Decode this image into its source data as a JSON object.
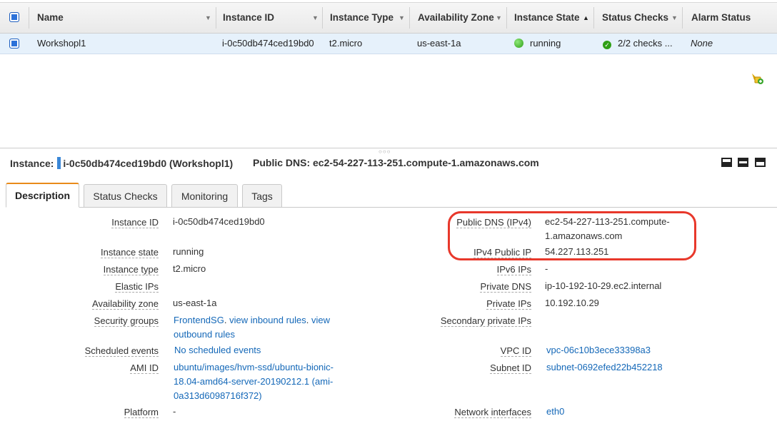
{
  "grid": {
    "columns": {
      "name": "Name",
      "instance_id": "Instance ID",
      "instance_type": "Instance Type",
      "availability_zone": "Availability Zone",
      "instance_state": "Instance State",
      "status_checks": "Status Checks",
      "alarm_status": "Alarm Status"
    },
    "row": {
      "name": "Workshopl1",
      "instance_id": "i-0c50db474ced19bd0",
      "instance_type": "t2.micro",
      "availability_zone": "us-east-1a",
      "instance_state": "running",
      "status_checks": "2/2 checks ...",
      "alarm_status": "None"
    }
  },
  "details": {
    "instance_label": "Instance:",
    "instance_value": "i-0c50db474ced19bd0 (Workshopl1)",
    "public_dns_label": "Public DNS:",
    "public_dns_value": "ec2-54-227-113-251.compute-1.amazonaws.com"
  },
  "tabs": [
    "Description",
    "Status Checks",
    "Monitoring",
    "Tags"
  ],
  "description": {
    "left": {
      "instance_id": {
        "label": "Instance ID",
        "value": "i-0c50db474ced19bd0"
      },
      "instance_state": {
        "label": "Instance state",
        "value": "running"
      },
      "instance_type": {
        "label": "Instance type",
        "value": "t2.micro"
      },
      "elastic_ips": {
        "label": "Elastic IPs",
        "value": ""
      },
      "availability_zone": {
        "label": "Availability zone",
        "value": "us-east-1a"
      },
      "security_groups": {
        "label": "Security groups",
        "group": "FrontendSG",
        "sep": ".",
        "inbound": "view inbound rules",
        "sep2": ".",
        "outbound_1": "view",
        "outbound_2": "outbound rules"
      },
      "scheduled_events": {
        "label": "Scheduled events",
        "value": "No scheduled events"
      },
      "ami_id": {
        "label": "AMI ID",
        "line1": "ubuntu/images/hvm-ssd/ubuntu-bionic-",
        "line2": "18.04-amd64-server-20190212.1 (ami-",
        "line3": "0a313d6098716f372)"
      },
      "platform": {
        "label": "Platform",
        "value": "-"
      }
    },
    "right": {
      "public_dns_ipv4": {
        "label": "Public DNS (IPv4)",
        "line1": "ec2-54-227-113-251.compute-",
        "line2": "1.amazonaws.com"
      },
      "ipv4_public_ip": {
        "label": "IPv4 Public IP",
        "value": "54.227.113.251"
      },
      "ipv6_ips": {
        "label": "IPv6 IPs",
        "value": "-"
      },
      "private_dns": {
        "label": "Private DNS",
        "value": "ip-10-192-10-29.ec2.internal"
      },
      "private_ips": {
        "label": "Private IPs",
        "value": "10.192.10.29"
      },
      "secondary_private_ips": {
        "label": "Secondary private IPs",
        "value": ""
      },
      "vpc_id": {
        "label": "VPC ID",
        "value": "vpc-06c10b3ece33398a3"
      },
      "subnet_id": {
        "label": "Subnet ID",
        "value": "subnet-0692efed22b452218"
      },
      "network_interfaces": {
        "label": "Network interfaces",
        "value": "eth0"
      }
    }
  },
  "colors": {
    "selected_row": "#e6f1fb",
    "link": "#1468b8",
    "running": "#2f9f16",
    "highlight": "#e8382b",
    "active_tab_accent": "#e88a1a"
  },
  "icons": [
    "select-all-checkbox",
    "sort-dropdown-icon",
    "sort-ascending-icon",
    "status-check-icon",
    "running-state-icon",
    "alarm-edit-icon",
    "pane-layout-icons"
  ]
}
